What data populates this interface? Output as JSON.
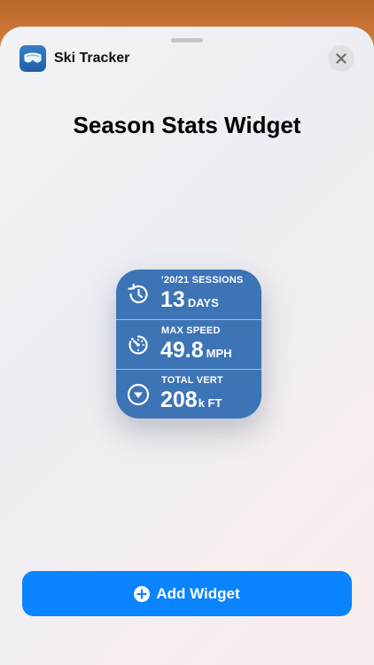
{
  "app": {
    "name": "Ski Tracker",
    "icon": "ski-goggles-icon"
  },
  "title": "Season Stats Widget",
  "widget": {
    "background": "#3c74b6",
    "stats": [
      {
        "label": "'20/21 SESSIONS",
        "value": "13",
        "unit": "DAYS",
        "icon": "history-clock-icon"
      },
      {
        "label": "MAX SPEED",
        "value": "49.8",
        "unit": "MPH",
        "icon": "speedometer-icon"
      },
      {
        "label": "TOTAL VERT",
        "value": "208",
        "unit": "k FT",
        "icon": "down-arrow-circle-icon"
      }
    ]
  },
  "add_button": {
    "label": "Add Widget",
    "color": "#0a84ff"
  },
  "close_icon": "close-icon"
}
